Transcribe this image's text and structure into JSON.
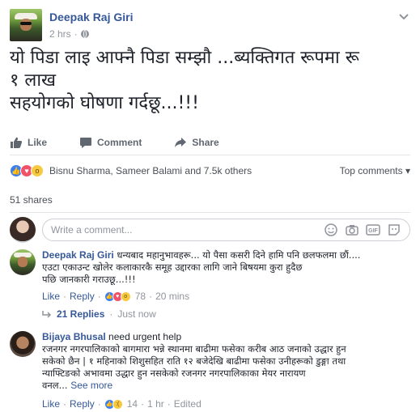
{
  "post": {
    "author": "Deepak Raj Giri",
    "time": "2 hrs",
    "sep": "·",
    "text_lines": [
      "यो पिडा लाइ आफ्नै पिडा सम्झौ ...ब्यक्तिगत रूपमा रू",
      "१ लाख",
      "सहयोगको घोषणा गर्दछू...!!!"
    ]
  },
  "actions": {
    "like": "Like",
    "comment": "Comment",
    "share": "Share"
  },
  "reactions": {
    "summary": "Bisnu Sharma, Sameer Balami and 7.5k others",
    "top_comments": "Top comments",
    "top_comments_caret": "▾"
  },
  "shares": "51 shares",
  "composer": {
    "placeholder": "Write a comment..."
  },
  "comments": [
    {
      "author": "Deepak Raj Giri",
      "lines": [
        "धन्यबाद महानुभावहरू... यो पैसा कसरी दिने हामि पनि छलफलमा छौं....",
        "एउटा एकाउन्ट खोलेर कलाकारकै समूह उद्दारका लागि जाने बिषयमा कुरा हुदैछ",
        "पछि जानकारी गराउछू...!!!"
      ],
      "like": "Like",
      "reply": "Reply",
      "reaction_count": "78",
      "time": "20 mins",
      "replies": "21 Replies",
      "replies_time": "Just now",
      "sep": "·"
    },
    {
      "author": "Bijaya Bhusal",
      "first_line": "need urgent help",
      "lines": [
        "रजनगर नगरपालिकाको बागमारा भन्ने स्थानमा बाढीमा फसेका करीब आठ जनाको उद्धार हुन",
        "सकेको छैन | १ महिनाको शिशुसहित राति १२ बजेदेखि बाढीमा फसेका उनीहरूको डुङ्गा तथा",
        "न्याफ्टिङको अभावमा उद्धार हुन नसकेको रजनगर नगरपालिकाका मेयर नारायण",
        "वनल..."
      ],
      "see_more": "See more",
      "like": "Like",
      "reply": "Reply",
      "reaction_count": "14",
      "time": "1 hr",
      "edited": "Edited",
      "sep": "·"
    }
  ]
}
